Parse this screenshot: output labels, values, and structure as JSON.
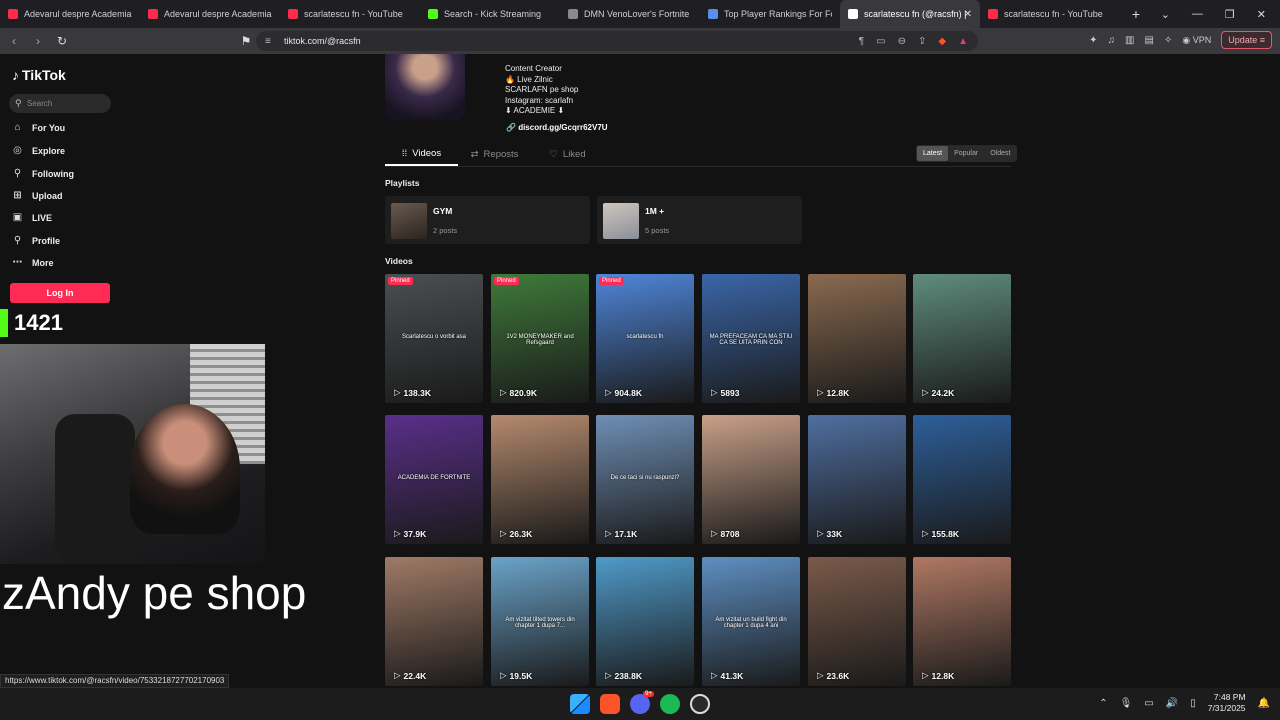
{
  "browser": {
    "tabs": [
      {
        "title": "Adevarul despre Academia de",
        "color": "#ff2b4a",
        "active": false
      },
      {
        "title": "Adevarul despre Academia de",
        "color": "#ff2b4a",
        "active": false
      },
      {
        "title": "scarlatescu fn - YouTube",
        "color": "#ff2b4a",
        "active": false
      },
      {
        "title": "Search - Kick Streaming",
        "color": "#53fc18",
        "active": false
      },
      {
        "title": "DMN VenoLover's Fortnite Eve",
        "color": "#8a8a8a",
        "active": false
      },
      {
        "title": "Top Player Rankings For Fortn",
        "color": "#5a8dee",
        "active": false
      },
      {
        "title": "scarlatescu fn (@racsfn) |",
        "color": "#ffffff",
        "active": true
      },
      {
        "title": "scarlatescu fn - YouTube",
        "color": "#ff2b4a",
        "active": false
      }
    ],
    "url": "tiktok.com/@racsfn",
    "vpn_label": "VPN",
    "update_label": "Update"
  },
  "sidebar": {
    "logo": "TikTok",
    "search_placeholder": "Search",
    "items": [
      {
        "label": "For You",
        "icon": "⌂"
      },
      {
        "label": "Explore",
        "icon": "◎"
      },
      {
        "label": "Following",
        "icon": "⚲"
      },
      {
        "label": "Upload",
        "icon": "⊞"
      },
      {
        "label": "LIVE",
        "icon": "▣"
      },
      {
        "label": "Profile",
        "icon": "⚲"
      },
      {
        "label": "More",
        "icon": "⋯"
      }
    ],
    "login_label": "Log In"
  },
  "stream_overlay": {
    "counter": "1421",
    "text": "zAndy pe shop"
  },
  "profile": {
    "bio_lines": [
      "Content Creator",
      "🔥 Live Zilnic",
      "SCARLAFN pe shop",
      "Instagram: scarlafn",
      "⬇ ACADEMIE ⬇"
    ],
    "link": "discord.gg/Gcqrr62V7U",
    "tabs": [
      "Videos",
      "Reposts",
      "Liked"
    ],
    "sort_options": [
      "Latest",
      "Popular",
      "Oldest"
    ],
    "playlists_label": "Playlists",
    "playlists": [
      {
        "name": "GYM",
        "count": "2 posts"
      },
      {
        "name": "1M +",
        "count": "5 posts"
      }
    ],
    "videos_label": "Videos",
    "videos": [
      {
        "views": "138.3K",
        "pinned": true,
        "caption": "Scarlatescu o vorbit asa",
        "bg": "#4a4f52"
      },
      {
        "views": "820.9K",
        "pinned": true,
        "caption": "1V2 MONEYMAKER and Refsgaard",
        "bg": "#3f7a3a"
      },
      {
        "views": "904.8K",
        "pinned": true,
        "caption": "scarlatescu fn",
        "bg": "#4f86d9"
      },
      {
        "views": "5893",
        "pinned": false,
        "caption": "MA PREFACEAM CA MA STIU CA SE UITA PRIN CON",
        "bg": "#3a66a8"
      },
      {
        "views": "12.8K",
        "pinned": false,
        "caption": "",
        "bg": "#8a6a50"
      },
      {
        "views": "24.2K",
        "pinned": false,
        "caption": "",
        "bg": "#5f8c7e"
      },
      {
        "views": "37.9K",
        "pinned": false,
        "caption": "ACADEMIA DE FORTNITE",
        "bg": "#5a2f8a"
      },
      {
        "views": "26.3K",
        "pinned": false,
        "caption": "",
        "bg": "#b58a6e"
      },
      {
        "views": "17.1K",
        "pinned": false,
        "caption": "De ce taci si nu raspunzi?",
        "bg": "#6f8fb5"
      },
      {
        "views": "8708",
        "pinned": false,
        "caption": "",
        "bg": "#c9a089"
      },
      {
        "views": "33K",
        "pinned": false,
        "caption": "",
        "bg": "#4f6fa0"
      },
      {
        "views": "155.8K",
        "pinned": false,
        "caption": "",
        "bg": "#2d5f9a"
      },
      {
        "views": "22.4K",
        "pinned": false,
        "caption": "",
        "bg": "#a07a66"
      },
      {
        "views": "19.5K",
        "pinned": false,
        "caption": "Am vizitat tilted towers din chapter 1 dupa 7...",
        "bg": "#6aa3c9"
      },
      {
        "views": "238.8K",
        "pinned": false,
        "caption": "",
        "bg": "#4f9ac9"
      },
      {
        "views": "41.3K",
        "pinned": false,
        "caption": "Am vizitat un build fight din chapter 1 dupa 4 ani",
        "bg": "#5e8fc2"
      },
      {
        "views": "23.6K",
        "pinned": false,
        "caption": "",
        "bg": "#7a5a4a"
      },
      {
        "views": "12.8K",
        "pinned": false,
        "caption": "",
        "bg": "#b07864"
      }
    ]
  },
  "status_url": "https://www.tiktok.com/@racsfn/video/7533218727702170903",
  "taskbar": {
    "time": "7:48 PM",
    "date": "7/31/2025",
    "badge": "9+"
  }
}
